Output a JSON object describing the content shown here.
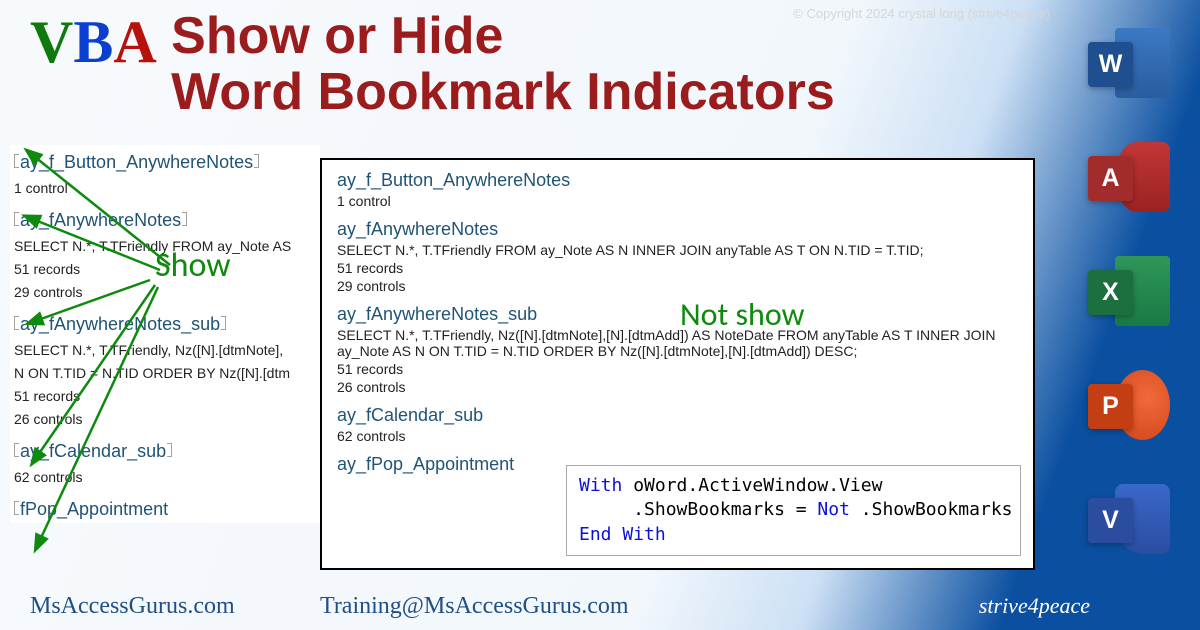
{
  "copyright": "© Copyright 2024 crystal long (strive4peace)",
  "vba": {
    "v": "V",
    "b": "B",
    "a": "A"
  },
  "title_line1": "Show or Hide",
  "title_line2": "Word Bookmark Indicators",
  "labels": {
    "show": "Show",
    "notshow": "Not show"
  },
  "bookmarks": {
    "b1": "ay_f_Button_AnywhereNotes",
    "b1s": "1 control",
    "b2": "ay_fAnywhereNotes",
    "b2s_short": "SELECT N.*, T.TFriendly FROM ay_Note AS",
    "b2s_full": "SELECT N.*, T.TFriendly FROM ay_Note AS N INNER JOIN anyTable AS T ON N.TID = T.TID;",
    "b2r": "51 records",
    "b2c": "29 controls",
    "b3": "ay_fAnywhereNotes_sub",
    "b3s_short1": "SELECT N.*, T.TFriendly, Nz([N].[dtmNote],",
    "b3s_short2": "N ON T.TID = N.TID ORDER BY Nz([N].[dtm",
    "b3s_full": "SELECT N.*, T.TFriendly, Nz([N].[dtmNote],[N].[dtmAdd]) AS NoteDate FROM anyTable AS T INNER JOIN ay_Note AS N ON T.TID = N.TID ORDER BY Nz([N].[dtmNote],[N].[dtmAdd]) DESC;",
    "b3r": "51 records",
    "b3c": "26 controls",
    "b4": "ay_fCalendar_sub",
    "b4c": "62 controls",
    "b5_short": "fPop_Appointment",
    "b5_full": "ay_fPop_Appointment"
  },
  "code": {
    "kw_with": "With",
    "rest_with": " oWord.ActiveWindow.View",
    "prop": "     .ShowBookmarks = ",
    "kw_not": "Not",
    "rest_not": " .ShowBookmarks",
    "kw_end": "End With"
  },
  "footer": {
    "site": "MsAccessGurus.com",
    "email": "Training@MsAccessGurus.com",
    "s4p": "strive4peace"
  },
  "apps": {
    "w": "W",
    "a": "A",
    "x": "X",
    "p": "P",
    "v": "V"
  }
}
